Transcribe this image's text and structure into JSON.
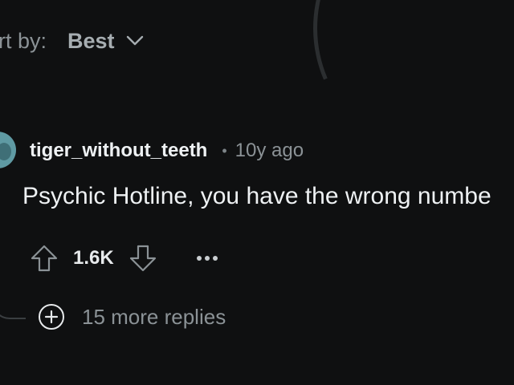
{
  "sort": {
    "label": "rt by:",
    "value": "Best",
    "chevron_icon": "chevron-down-icon"
  },
  "comment": {
    "username": "tiger_without_teeth",
    "separator": "•",
    "timestamp": "10y ago",
    "text": "Psychic Hotline, you have the wrong numbe",
    "score": "1.6K",
    "upvote_icon": "upvote-arrow-icon",
    "downvote_icon": "downvote-arrow-icon",
    "more_icon": "more-options-icon",
    "avatar_icon": "user-avatar-icon"
  },
  "replies": {
    "label": "15 more replies",
    "icon": "plus-circle-icon"
  },
  "colors": {
    "background": "#0f1011",
    "primary_text": "#eef1f3",
    "secondary_text": "#8b9296",
    "avatar": "#5f9aa3"
  }
}
